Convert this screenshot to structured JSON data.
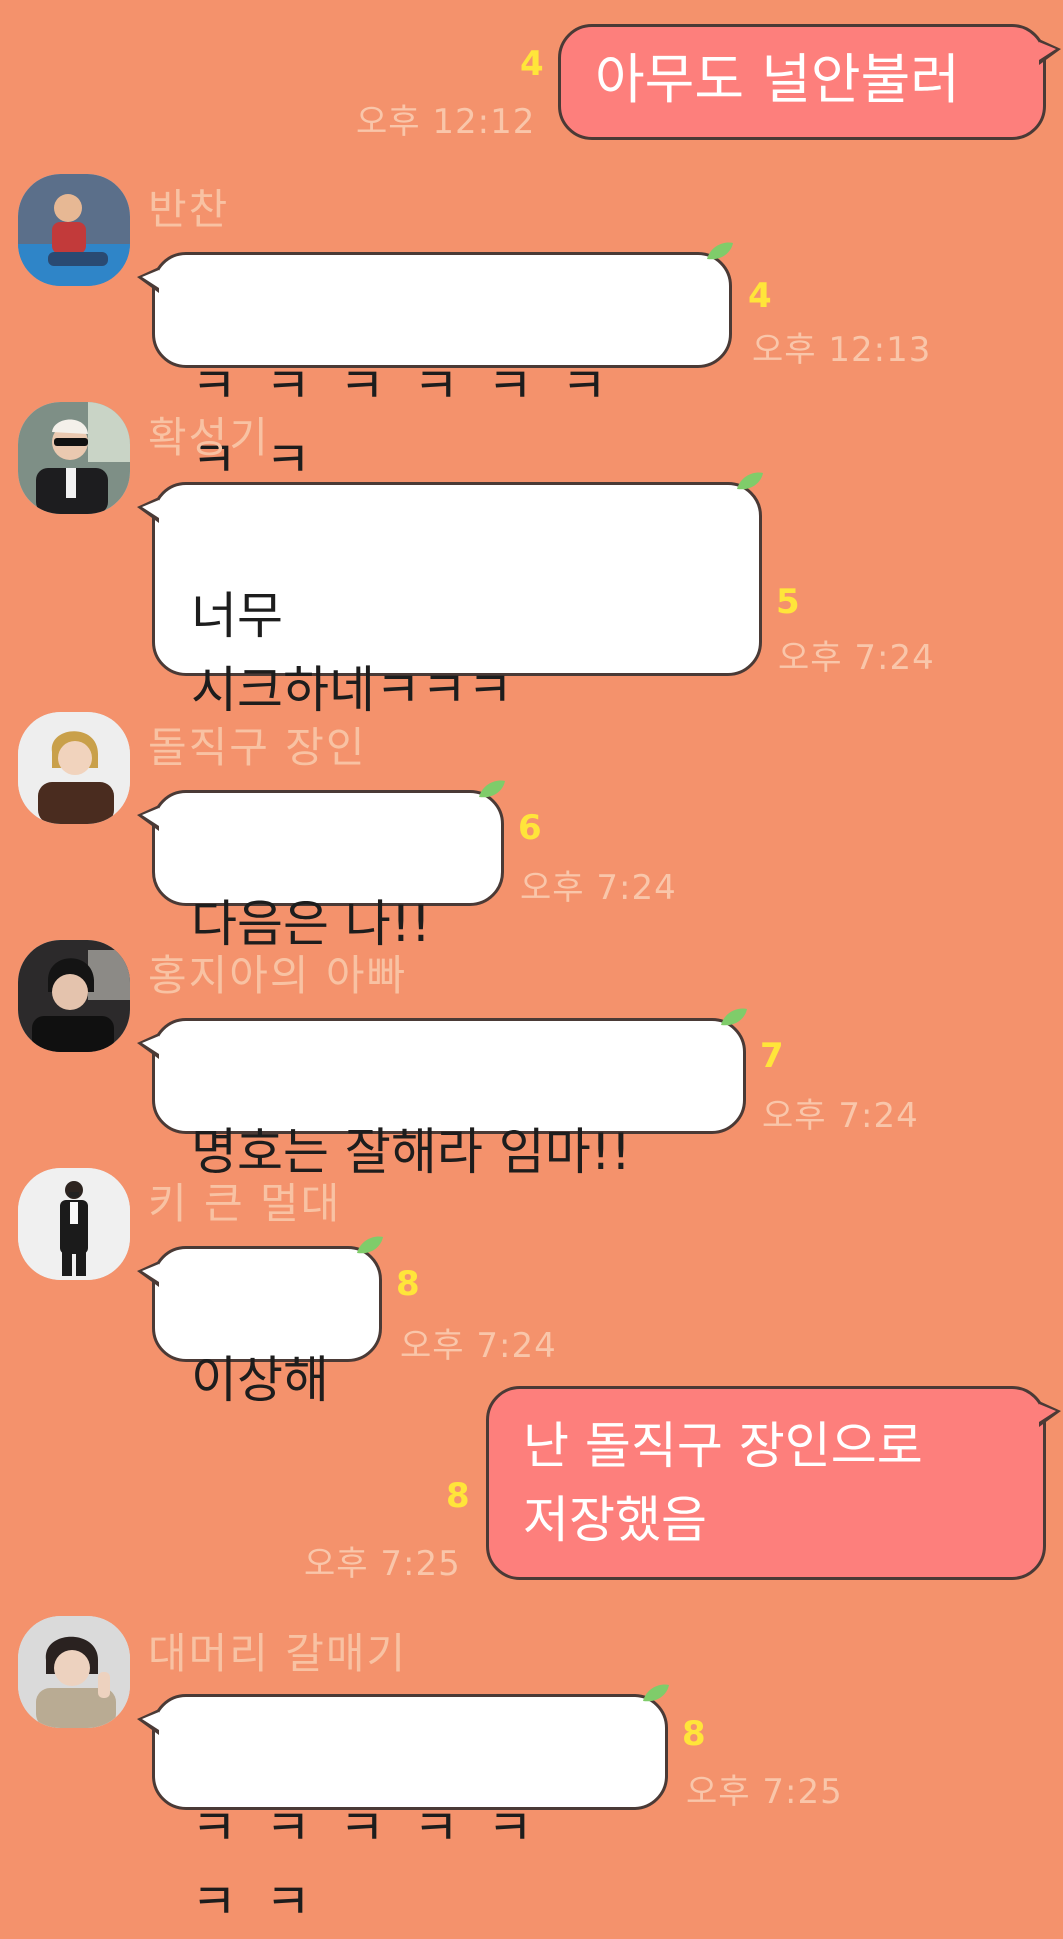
{
  "messages": [
    {
      "id": "m1",
      "text": "아무도 널안불러",
      "unread": "4",
      "time": "오후 12:12"
    },
    {
      "id": "m2",
      "sender": "반찬",
      "text": "ㅋㅋㅋㅋㅋㅋㅋㅋ",
      "unread": "4",
      "time": "오후 12:13"
    },
    {
      "id": "m3",
      "sender": "확성기",
      "text": "너무\n시크하네ㅋㅋㅋ",
      "unread": "5",
      "time": "오후 7:24"
    },
    {
      "id": "m4",
      "sender": "돌직구 장인",
      "text": "다음은 나!!",
      "unread": "6",
      "time": "오후 7:24"
    },
    {
      "id": "m5",
      "sender": "홍지아의 아빠",
      "text": "명호는 잘해라 임마!!",
      "unread": "7",
      "time": "오후 7:24"
    },
    {
      "id": "m6",
      "sender": "키 큰 멀대",
      "text": "이상해",
      "unread": "8",
      "time": "오후 7:24"
    },
    {
      "id": "m7",
      "text": "난 돌직구 장인으로\n저장했음",
      "unread": "8",
      "time": "오후 7:25"
    },
    {
      "id": "m8",
      "sender": "대머리 갈매기",
      "text": "ㅋㅋㅋㅋㅋㅋㅋ",
      "unread": "8",
      "time": "오후 7:25"
    }
  ],
  "colors": {
    "background": "#f4926c",
    "outgoing_bubble": "#fd7f7c",
    "incoming_bubble": "#ffffff",
    "unread_count": "#ffe53a",
    "timestamp": "#f9c6aa"
  }
}
